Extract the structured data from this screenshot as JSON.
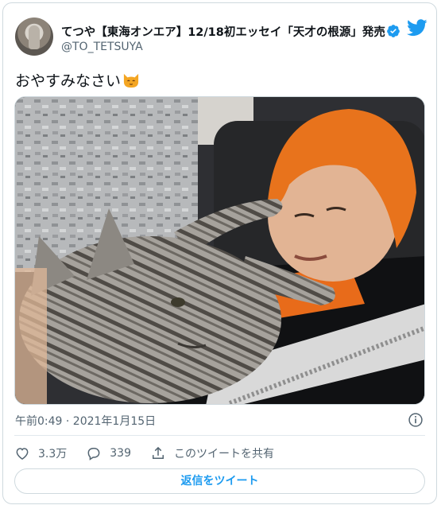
{
  "author": {
    "display_name": "てつや【東海オンエア】12/18初エッセイ「天才の根源」発売",
    "handle": "@TO_TETSUYA",
    "verified": true
  },
  "tweet": {
    "text": "おやすみなさい"
  },
  "meta": {
    "timestamp": "午前0:49 · 2021年1月15日"
  },
  "actions": {
    "likes": "3.3万",
    "replies": "339",
    "share_label": "このツイートを共有"
  },
  "reply_button": {
    "label": "返信をツイート"
  },
  "colors": {
    "brand": "#1d9bf0",
    "secondary_text": "#536471",
    "border": "#cfd9de"
  },
  "icons": [
    "twitter-bird-icon",
    "verified-badge-icon",
    "cat-emoji-icon",
    "info-icon",
    "heart-icon",
    "reply-icon",
    "share-icon"
  ]
}
